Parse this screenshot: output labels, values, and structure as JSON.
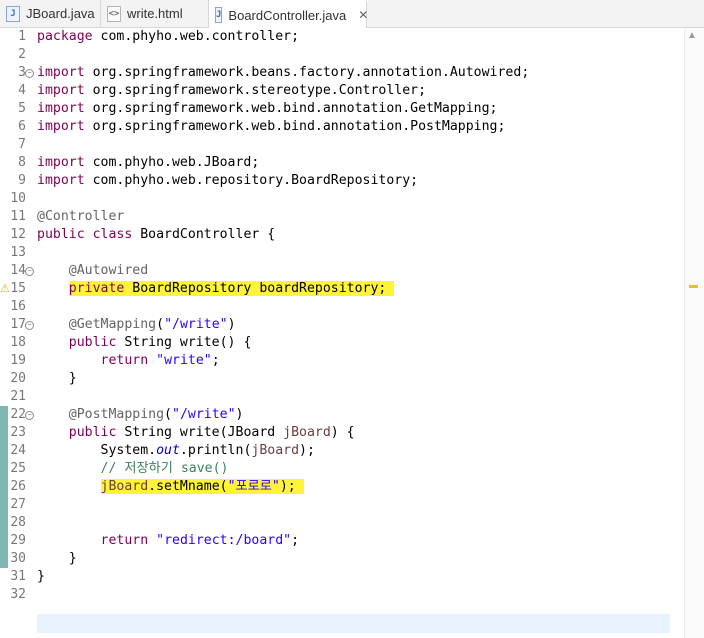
{
  "tabs": [
    {
      "label": "JBoard.java",
      "icon": "java-file-icon",
      "active": false
    },
    {
      "label": "write.html",
      "icon": "html-file-icon",
      "active": false
    },
    {
      "label": "BoardController.java",
      "icon": "java-file-icon",
      "active": true,
      "close": "✕"
    }
  ],
  "editor": {
    "line_numbers": [
      "1",
      "2",
      "3",
      "4",
      "5",
      "6",
      "7",
      "8",
      "9",
      "10",
      "11",
      "12",
      "13",
      "14",
      "15",
      "16",
      "17",
      "18",
      "19",
      "20",
      "21",
      "22",
      "23",
      "24",
      "25",
      "26",
      "27",
      "28",
      "29",
      "30",
      "31",
      "32"
    ],
    "fold_markers": [
      "3",
      "14",
      "17",
      "22"
    ],
    "warning_line": "15",
    "changed_lines": [
      "22",
      "23",
      "24",
      "25",
      "26",
      "27",
      "28",
      "29",
      "30"
    ],
    "current_line": "32",
    "highlighted_lines": [
      "15",
      "26"
    ],
    "highlight_color": "#fff43a",
    "lines": [
      "package com.phyho.web.controller;",
      "",
      "import org.springframework.beans.factory.annotation.Autowired;",
      "import org.springframework.stereotype.Controller;",
      "import org.springframework.web.bind.annotation.GetMapping;",
      "import org.springframework.web.bind.annotation.PostMapping;",
      "",
      "import com.phyho.web.JBoard;",
      "import com.phyho.web.repository.BoardRepository;",
      "",
      "@Controller",
      "public class BoardController {",
      "",
      "    @Autowired",
      "    private BoardRepository boardRepository;",
      "",
      "    @GetMapping(\"/write\")",
      "    public String write() {",
      "        return \"write\";",
      "    }",
      "",
      "    @PostMapping(\"/write\")",
      "    public String write(JBoard jBoard) {",
      "        System.out.println(jBoard);",
      "        // 저장하기 save()",
      "        jBoard.setMname(\"포로로\");",
      "",
      "",
      "        return \"redirect:/board\";",
      "    }",
      "}",
      ""
    ]
  },
  "colors": {
    "keyword": "#7f0055",
    "string": "#2a00ff",
    "annotation": "#646464",
    "comment": "#3f7f5f",
    "static_field": "#0000c0",
    "local_variable": "#6a3e3e",
    "current_line_bg": "#e8f2fe",
    "change_bar": "#7fb8b2"
  },
  "overview": {
    "up_arrow": "▲",
    "down_arrow": "▼"
  }
}
